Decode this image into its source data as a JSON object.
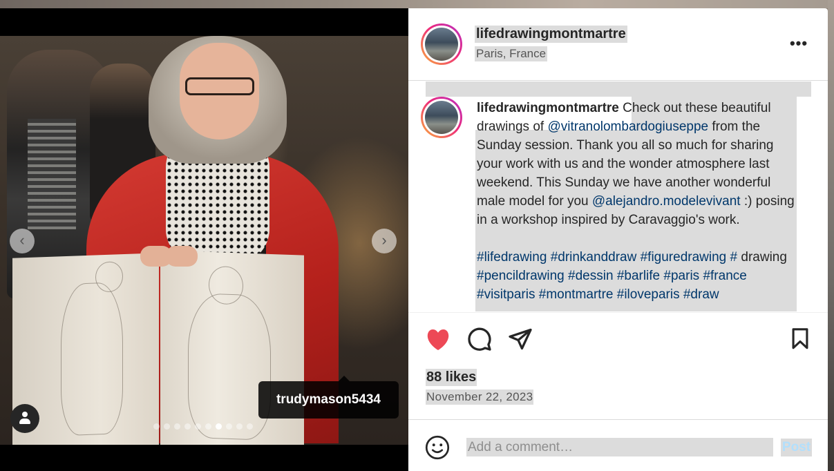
{
  "post": {
    "username": "lifedrawingmontmartre",
    "location": "Paris, France",
    "more_label": "•••"
  },
  "caption": {
    "username": "lifedrawingmontmartre",
    "text_1": " Check out these beautiful drawings of ",
    "mention_1": "@vitranolombardogiuseppe",
    "text_2": " from the Sunday session. Thank you all so much for sharing your work with us and the wonder atmosphere last weekend. This Sunday we have another wonderful male model for you ",
    "mention_2": "@alejandro.modelevivant",
    "text_3": " :) posing in a workshop inspired by Caravaggio's work.",
    "hashtags": [
      "#lifedrawing",
      "#drinkanddraw",
      "#figuredrawing",
      "#",
      "drawing",
      "#pencildrawing",
      "#dessin",
      "#barlife",
      "#paris",
      "#france",
      "#visitparis",
      "#montmartre",
      "#iloveparis",
      "#draw"
    ]
  },
  "media": {
    "tagged_user": "trudymason5434",
    "prev_label": "‹",
    "next_label": "›",
    "carousel_count": 10,
    "carousel_active_index": 6
  },
  "stats": {
    "likes": "88 likes",
    "date": "November 22, 2023"
  },
  "comment": {
    "placeholder": "Add a comment…",
    "post_label": "Post"
  },
  "icons": {
    "heart": "heart-filled-icon",
    "comment": "comment-bubble-icon",
    "share": "paper-plane-icon",
    "save": "bookmark-icon",
    "emoji": "smiley-icon",
    "user_tag": "person-icon"
  },
  "colors": {
    "like_red": "#ed4956",
    "link_blue": "#00376b",
    "post_button": "#b2dffc"
  }
}
